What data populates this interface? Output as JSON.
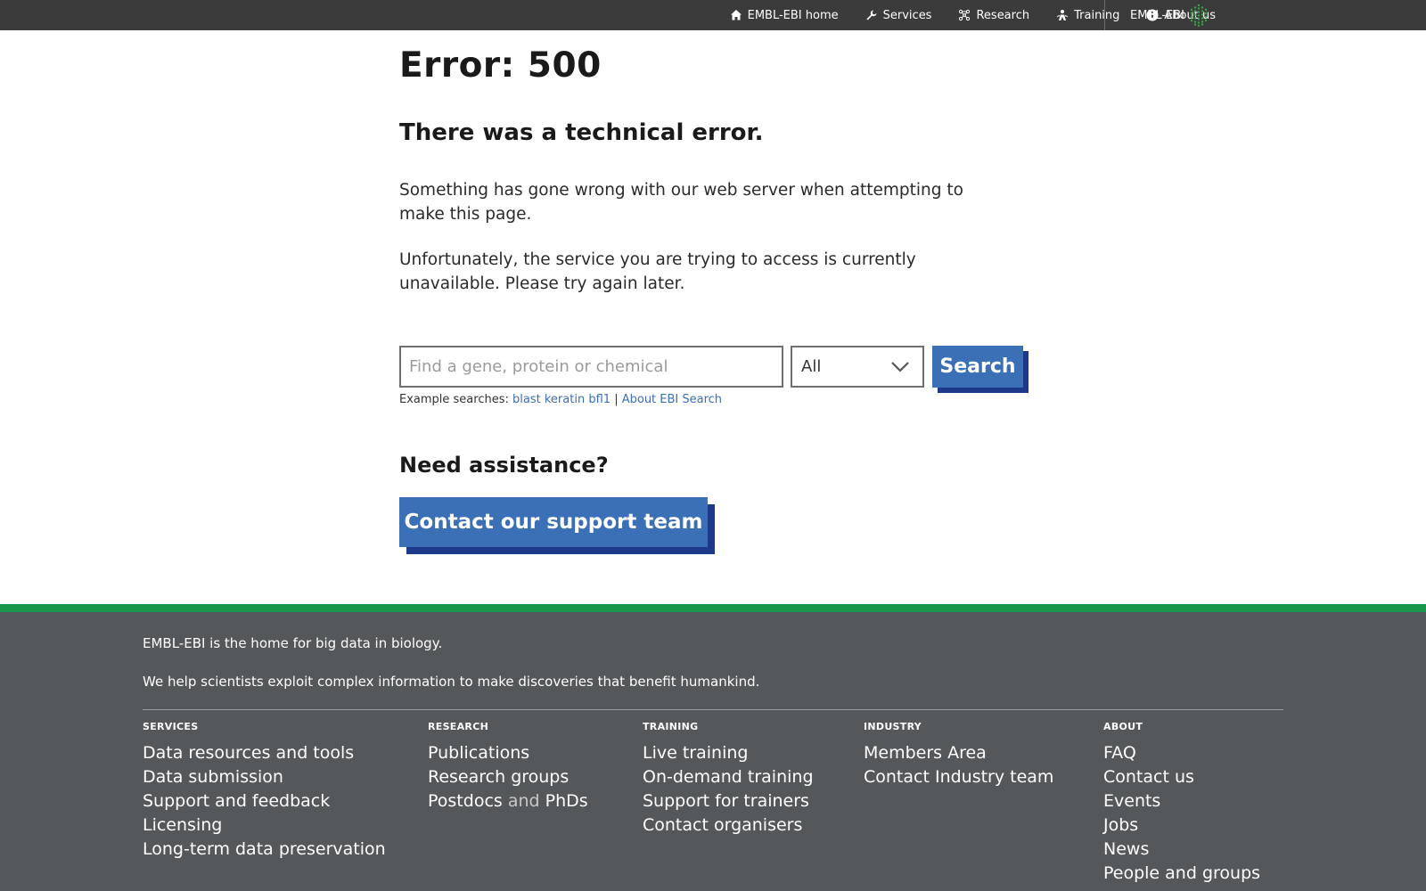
{
  "topnav": {
    "items": [
      {
        "label": "EMBL-EBI home",
        "icon": "home-icon"
      },
      {
        "label": "Services",
        "icon": "wrench-icon"
      },
      {
        "label": "Research",
        "icon": "network-icon"
      },
      {
        "label": "Training",
        "icon": "training-icon"
      },
      {
        "label": "About us",
        "icon": "info-icon"
      }
    ],
    "brand": "EMBL-EBI"
  },
  "main": {
    "title": "Error: 500",
    "subtitle": "There was a technical error.",
    "paragraph1": "Something has gone wrong with our web server when attempting to make this page.",
    "paragraph2": "Unfortunately, the service you are trying to access is currently unavailable. Please try again later."
  },
  "search": {
    "placeholder": "Find a gene, protein or chemical",
    "value": "",
    "scope_selected": "All",
    "button_label": "Search",
    "examples_label": "Example searches:",
    "examples": [
      "blast",
      "keratin",
      "bfl1"
    ],
    "separator": "|",
    "about_link": "About EBI Search"
  },
  "assistance": {
    "title": "Need assistance?",
    "button_label": "Contact our support team"
  },
  "footer": {
    "tagline1": "EMBL-EBI is the home for big data in biology.",
    "tagline2": "We help scientists exploit complex information to make discoveries that benefit humankind.",
    "columns": [
      {
        "heading": "SERVICES",
        "links": [
          "Data resources and tools",
          "Data submission",
          "Support and feedback",
          "Licensing",
          "Long-term data preservation"
        ]
      },
      {
        "heading": "RESEARCH",
        "links": [
          "Publications",
          "Research groups",
          "Postdocs",
          "and",
          "PhDs"
        ]
      },
      {
        "heading": "TRAINING",
        "links": [
          "Live training",
          "On-demand training",
          "Support for trainers",
          "Contact organisers"
        ]
      },
      {
        "heading": "INDUSTRY",
        "links": [
          "Members Area",
          "Contact Industry team"
        ]
      },
      {
        "heading": "ABOUT",
        "links": [
          "FAQ",
          "Contact us",
          "Events",
          "Jobs",
          "News",
          "People and groups"
        ]
      }
    ]
  },
  "colors": {
    "topbar": "#3b3b3b",
    "accent_blue": "#3b6fb6",
    "button_shadow": "#1d3a8a",
    "footer_green": "#18974c",
    "footer_bg": "#54585a"
  }
}
